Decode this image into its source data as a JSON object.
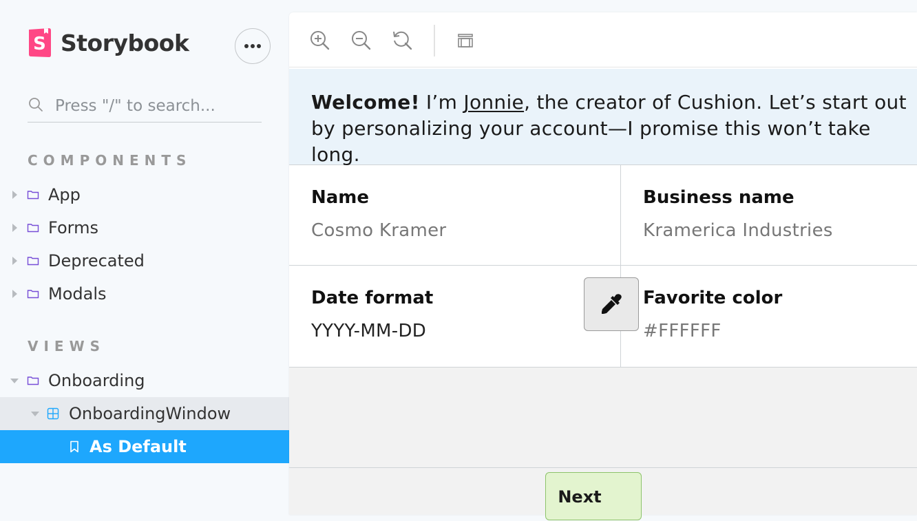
{
  "sidebar": {
    "brand": {
      "name": "Storybook",
      "logo_icon": "storybook-logo-icon",
      "accent": "#ff4785"
    },
    "menu_icon": "ellipsis-icon",
    "search": {
      "placeholder": "Press \"/\" to search...",
      "value": "",
      "icon": "search-icon"
    },
    "sections": [
      {
        "title": "COMPONENTS",
        "items": [
          {
            "label": "App",
            "icon": "folder-icon",
            "expanded": false
          },
          {
            "label": "Forms",
            "icon": "folder-icon",
            "expanded": false
          },
          {
            "label": "Deprecated",
            "icon": "folder-icon",
            "expanded": false
          },
          {
            "label": "Modals",
            "icon": "folder-icon",
            "expanded": false
          }
        ]
      },
      {
        "title": "VIEWS",
        "items": [
          {
            "label": "Onboarding",
            "icon": "folder-icon",
            "expanded": true
          },
          {
            "label": "OnboardingWindow",
            "icon": "component-icon",
            "expanded": true
          },
          {
            "label": "As Default",
            "icon": "bookmark-icon",
            "selected": true
          }
        ]
      }
    ],
    "selected_color": "#1ea7fd"
  },
  "toolbar": {
    "tools": [
      "zoom-in-icon",
      "zoom-out-icon",
      "reset-zoom-icon",
      "background-icon"
    ]
  },
  "preview": {
    "welcome": {
      "bold": "Welcome!",
      "pre": " I’m ",
      "link": "Jonnie",
      "post": ", the creator of Cushion. Let’s start out by personalizing your account—I promise this won’t take long."
    },
    "fields": [
      {
        "label": "Name",
        "value": "Cosmo Kramer"
      },
      {
        "label": "Business name",
        "value": "Kramerica Industries"
      },
      {
        "label": "Date format",
        "value": "YYYY-MM-DD"
      },
      {
        "label": "Favorite color",
        "value": "#FFFFFF"
      }
    ],
    "picker_icon": "eyedropper-icon",
    "next_label": "Next"
  }
}
